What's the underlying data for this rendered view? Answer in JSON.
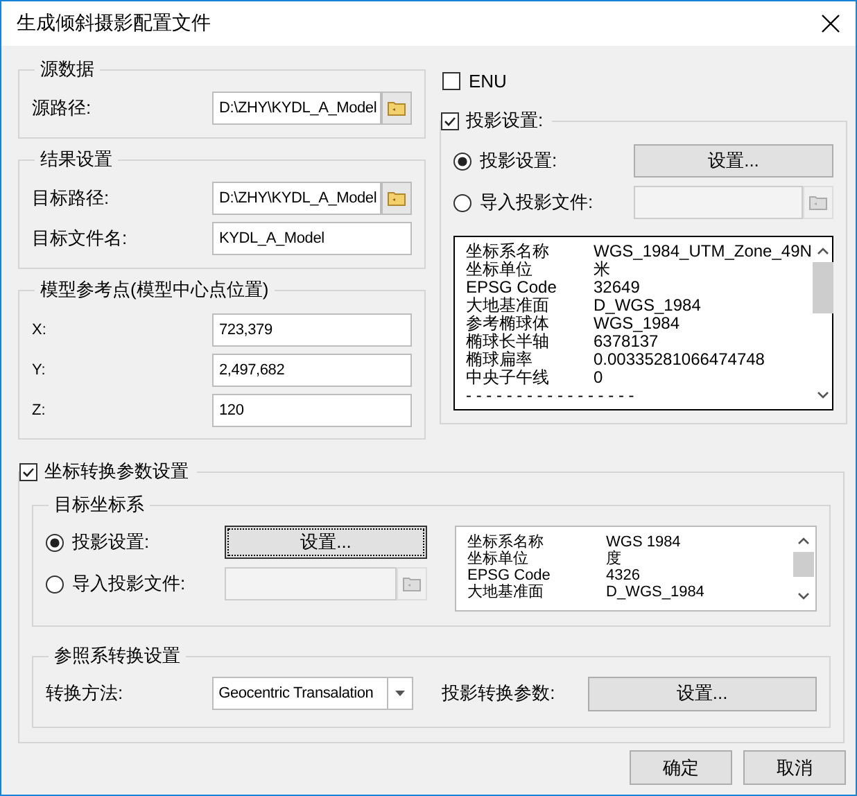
{
  "window": {
    "title": "生成倾斜摄影配置文件"
  },
  "groups": [
    {
      "title": "源数据",
      "fields": [
        {
          "kind": "browse",
          "label": "源路径:",
          "value": "D:\\ZHY\\KYDL_A_Model"
        }
      ]
    },
    {
      "title": "结果设置",
      "fields": [
        {
          "kind": "browse",
          "label": "目标路径:",
          "value": "D:\\ZHY\\KYDL_A_Model"
        },
        {
          "kind": "text",
          "label": "目标文件名:",
          "value": "KYDL_A_Model"
        }
      ]
    },
    {
      "title": "模型参考点(模型中心点位置)",
      "fields": [
        {
          "kind": "small",
          "label": "X:",
          "value": "723,379"
        },
        {
          "kind": "small",
          "label": "Y:",
          "value": "2,497,682"
        },
        {
          "kind": "small",
          "label": "Z:",
          "value": "120"
        }
      ]
    }
  ],
  "enu": {
    "label": "ENU",
    "checked": false
  },
  "projection": {
    "label": "投影设置:",
    "checked": true,
    "options": [
      {
        "kind": "button",
        "label": "投影设置:",
        "selected": true,
        "button": "设置...",
        "focused": false
      },
      {
        "kind": "file",
        "label": "导入投影文件:",
        "selected": false
      }
    ],
    "info": [
      {
        "key": "坐标系名称",
        "value": "WGS_1984_UTM_Zone_49N"
      },
      {
        "key": "坐标单位",
        "value": "米"
      },
      {
        "key": "EPSG Code",
        "value": "32649"
      },
      {
        "key": "大地基准面",
        "value": "D_WGS_1984"
      },
      {
        "key": "参考椭球体",
        "value": "WGS_1984"
      },
      {
        "key": "椭球长半轴",
        "value": "6378137"
      },
      {
        "key": "椭球扁率",
        "value": "0.00335281066474748"
      },
      {
        "key": "中央子午线",
        "value": "0"
      },
      {
        "key": "- - - - - - - - - - - - - - - - -"
      }
    ]
  },
  "transform": {
    "label": "坐标转换参数设置",
    "checked": true,
    "target": {
      "title": "目标坐标系",
      "options": [
        {
          "kind": "button",
          "label": "投影设置:",
          "selected": true,
          "button": "设置...",
          "focused": true
        },
        {
          "kind": "file",
          "label": "导入投影文件:",
          "selected": false
        }
      ],
      "info": [
        {
          "key": "坐标系名称",
          "value": "WGS 1984"
        },
        {
          "key": "坐标单位",
          "value": "度"
        },
        {
          "key": "EPSG Code",
          "value": "4326"
        },
        {
          "key": "大地基准面",
          "value": "D_WGS_1984"
        }
      ]
    },
    "reference": {
      "title": "参照系转换设置",
      "method_label": "转换方法:",
      "method": "Geocentric Transalation",
      "param_label": "投影转换参数:",
      "param_button": "设置..."
    }
  },
  "buttons": [
    "确定",
    "取消"
  ]
}
